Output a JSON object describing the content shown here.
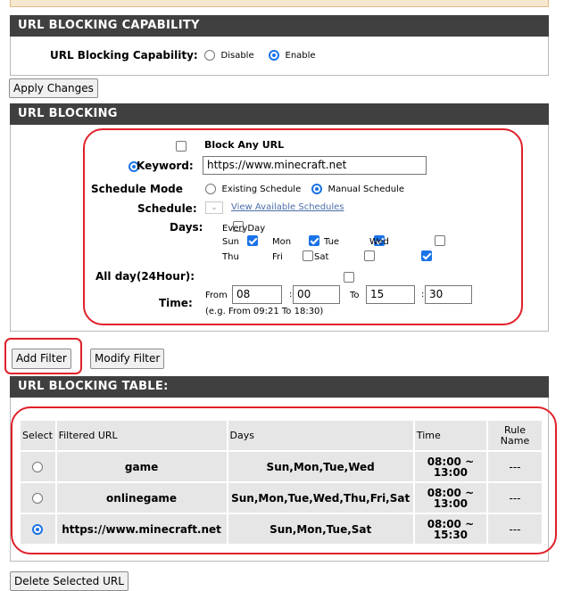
{
  "capability": {
    "header": "URL BLOCKING CAPABILITY",
    "label": "URL Blocking Capability:",
    "disable": "Disable",
    "enable": "Enable",
    "selected": "Enable"
  },
  "apply_button": "Apply Changes",
  "blocking": {
    "header": "URL BLOCKING",
    "block_any_url": "Block Any URL",
    "keyword_label": "Keyword:",
    "keyword_value": "https://www.minecraft.net",
    "schedule_mode_label": "Schedule Mode",
    "existing_schedule": "Existing Schedule",
    "manual_schedule": "Manual Schedule",
    "schedule_label": "Schedule:",
    "view_schedules": "View Available Schedules",
    "days_label": "Days:",
    "everyday": "EveryDay",
    "days": {
      "sun": "Sun",
      "mon": "Mon",
      "tue": "Tue",
      "wed": "Wed",
      "thu": "Thu",
      "fri": "Fri",
      "sat": "Sat"
    },
    "allday_label": "All day(24Hour):",
    "time_label": "Time:",
    "from": "From",
    "to": "To",
    "from_hour": "08",
    "from_min": "00",
    "to_hour": "15",
    "to_min": "30",
    "example": "(e.g. From 09:21 To 18:30)"
  },
  "buttons": {
    "add_filter": "Add Filter",
    "modify_filter": "Modify Filter",
    "delete_selected": "Delete Selected URL"
  },
  "table": {
    "header": "URL BLOCKING TABLE:",
    "columns": [
      "Select",
      "Filtered URL",
      "Days",
      "Time",
      "Rule Name"
    ],
    "rows": [
      {
        "url": "game",
        "days": "Sun,Mon,Tue,Wed",
        "time": "08:00 ~ 13:00",
        "rule": "---",
        "selected": false
      },
      {
        "url": "onlinegame",
        "days": "Sun,Mon,Tue,Wed,Thu,Fri,Sat",
        "time": "08:00 ~ 13:00",
        "rule": "---",
        "selected": false
      },
      {
        "url": "https://www.minecraft.net",
        "days": "Sun,Mon,Tue,Sat",
        "time": "08:00 ~ 15:30",
        "rule": "---",
        "selected": true
      }
    ]
  },
  "colors": {
    "header_bg": "#404040",
    "annotation": "#e0202a",
    "accent": "#1a73e8"
  }
}
